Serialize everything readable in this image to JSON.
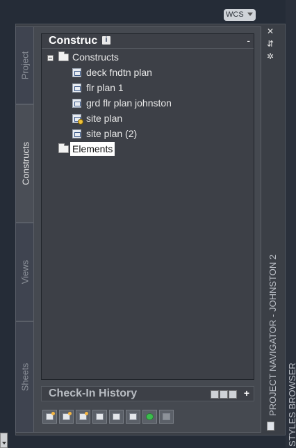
{
  "wcs": {
    "label": "WCS"
  },
  "tabs": [
    {
      "label": "Project",
      "active": false
    },
    {
      "label": "Constructs",
      "active": true
    },
    {
      "label": "Views",
      "active": false
    },
    {
      "label": "Sheets",
      "active": false
    }
  ],
  "tree_panel": {
    "title": "Construc",
    "info_icon": "i",
    "collapse_label": "-",
    "root": {
      "label": "Constructs",
      "icon": "open-folder-icon"
    },
    "items": [
      {
        "label": "deck fndtn plan",
        "icon": "construct-icon"
      },
      {
        "label": "flr plan 1",
        "icon": "construct-icon"
      },
      {
        "label": "grd flr plan johnston",
        "icon": "construct-icon"
      },
      {
        "label": "site plan",
        "icon": "construct-warning-icon"
      },
      {
        "label": "site plan (2)",
        "icon": "construct-icon"
      }
    ],
    "elements": {
      "label": "Elements",
      "icon": "folder-icon",
      "selected": true
    }
  },
  "checkin": {
    "title": "Check-In History",
    "expand_label": "+"
  },
  "toolbar": {
    "buttons": [
      "new-construct-icon",
      "new-element-icon",
      "new-category-icon",
      "properties-icon",
      "repath-icon",
      "sheet-set-icon",
      "refresh-icon",
      "disabled-icon"
    ]
  },
  "side": {
    "project_navigator_title": "PROJECT NAVIGATOR - JOHNSTON 2",
    "styles_browser_title": "STYLES BROWSER",
    "close_label": "✕",
    "pin_label": "⇵",
    "settings_label": "✲"
  }
}
